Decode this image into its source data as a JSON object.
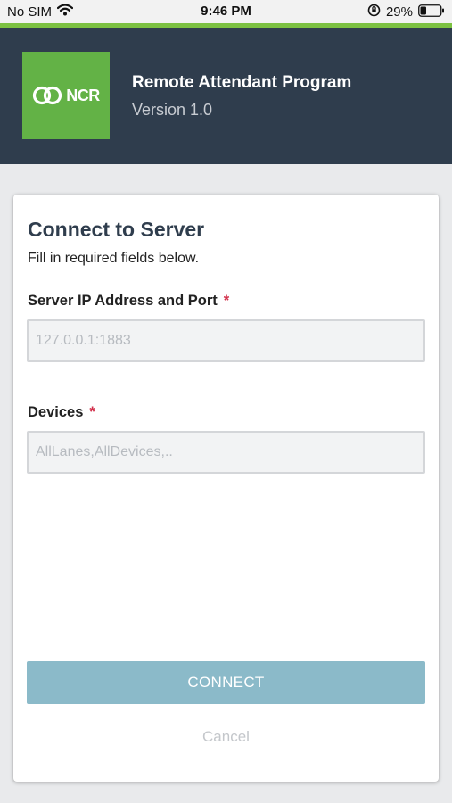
{
  "status_bar": {
    "carrier": "No SIM",
    "time": "9:46 PM",
    "battery": "29%"
  },
  "header": {
    "logo_text": "NCR",
    "title": "Remote Attendant Program",
    "version": "Version 1.0"
  },
  "form": {
    "title": "Connect to Server",
    "subtitle": "Fill in required fields below.",
    "required_mark": "*",
    "server": {
      "label": "Server IP Address and Port",
      "placeholder": "127.0.0.1:1883",
      "value": ""
    },
    "devices": {
      "label": "Devices",
      "placeholder": "AllLanes,AllDevices,..",
      "value": ""
    },
    "connect_label": "CONNECT",
    "cancel_label": "Cancel"
  },
  "colors": {
    "accent_green": "#7cc142",
    "header_bg": "#2f3d4d",
    "connect_disabled": "#8bbac9",
    "required": "#d2304b"
  }
}
